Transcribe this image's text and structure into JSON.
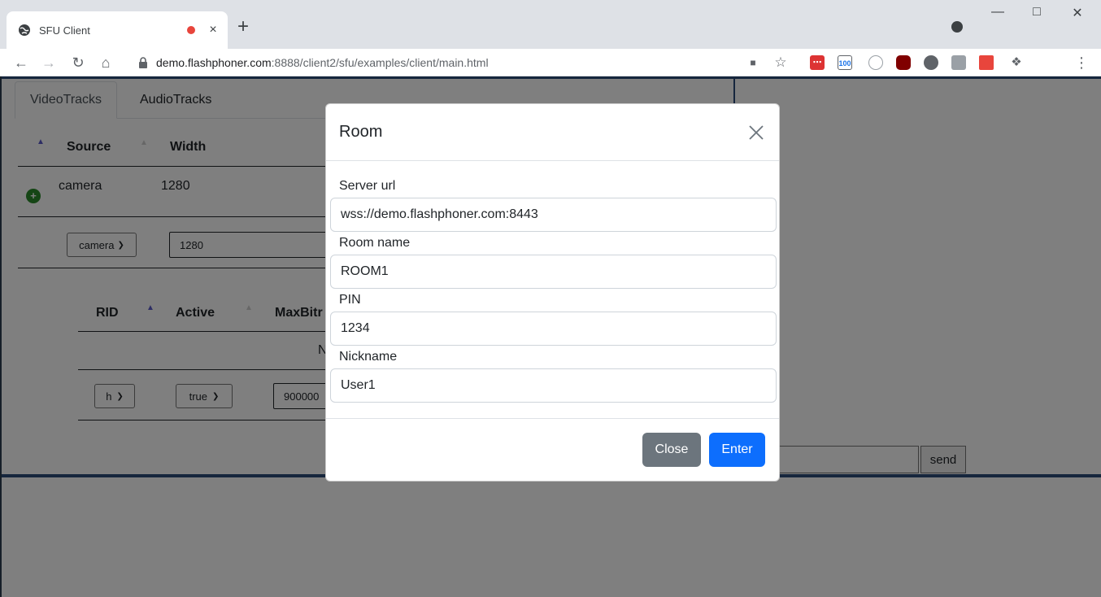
{
  "browser": {
    "tab_title": "SFU Client",
    "tab_close": "×",
    "new_tab": "+",
    "url_host": "demo.flashphoner.com",
    "url_path": ":8888/client2/sfu/examples/client/main.html",
    "ext_100_label": "100"
  },
  "page": {
    "tabs": [
      {
        "label": "VideoTracks"
      },
      {
        "label": "AudioTracks"
      }
    ],
    "tracks_table": {
      "headers": [
        "Source",
        "Width"
      ],
      "row": {
        "source": "camera",
        "width": "1280"
      }
    },
    "track_form": {
      "source_select": "camera",
      "width_value": "1280"
    },
    "encodings_table": {
      "headers": [
        "RID",
        "Active",
        "MaxBitr"
      ],
      "placeholder_row": "N"
    },
    "encoding_form": {
      "rid_select": "h",
      "active_select": "true",
      "maxbitrate_value": "900000"
    },
    "chat": {
      "send_label": "send"
    }
  },
  "modal": {
    "title": "Room",
    "fields": [
      {
        "label": "Server url",
        "value": "wss://demo.flashphoner.com:8443"
      },
      {
        "label": "Room name",
        "value": "ROOM1"
      },
      {
        "label": "PIN",
        "value": "1234"
      },
      {
        "label": "Nickname",
        "value": "User1"
      }
    ],
    "close_label": "Close",
    "enter_label": "Enter"
  },
  "colors": {
    "primary": "#0d6efd",
    "secondary": "#6c757d",
    "accent_rule": "#2c4d7a"
  }
}
